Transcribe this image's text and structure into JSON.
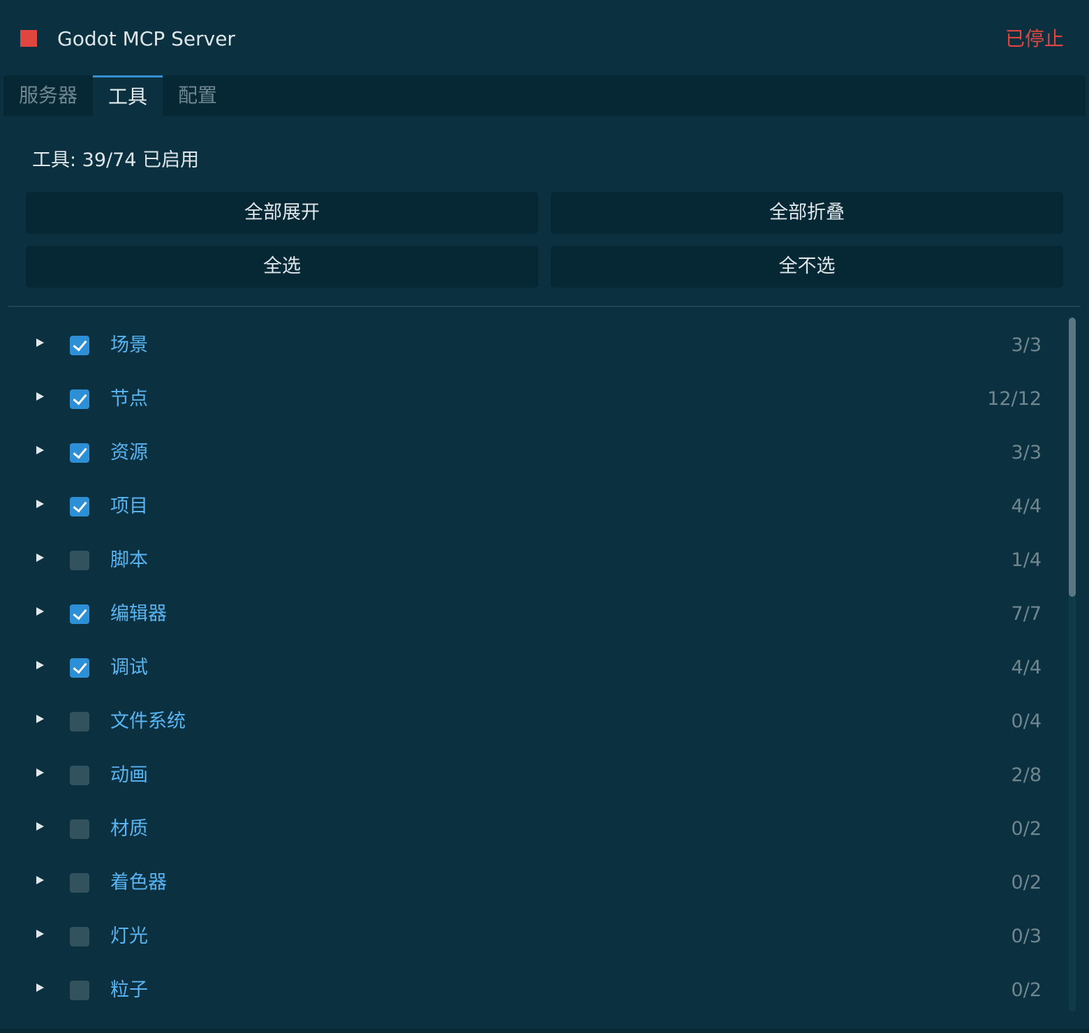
{
  "header": {
    "title": "Godot MCP Server",
    "status": "已停止",
    "status_color": "#e0463f"
  },
  "tabs": [
    {
      "label": "服务器",
      "active": false
    },
    {
      "label": "工具",
      "active": true
    },
    {
      "label": "配置",
      "active": false
    }
  ],
  "summary": "工具: 39/74 已启用",
  "buttons": {
    "expand_all": "全部展开",
    "collapse_all": "全部折叠",
    "select_all": "全选",
    "select_none": "全不选"
  },
  "categories": [
    {
      "label": "场景",
      "count": "3/3",
      "checked": true
    },
    {
      "label": "节点",
      "count": "12/12",
      "checked": true
    },
    {
      "label": "资源",
      "count": "3/3",
      "checked": true
    },
    {
      "label": "项目",
      "count": "4/4",
      "checked": true
    },
    {
      "label": "脚本",
      "count": "1/4",
      "checked": false
    },
    {
      "label": "编辑器",
      "count": "7/7",
      "checked": true
    },
    {
      "label": "调试",
      "count": "4/4",
      "checked": true
    },
    {
      "label": "文件系统",
      "count": "0/4",
      "checked": false
    },
    {
      "label": "动画",
      "count": "2/8",
      "checked": false
    },
    {
      "label": "材质",
      "count": "0/2",
      "checked": false
    },
    {
      "label": "着色器",
      "count": "0/2",
      "checked": false
    },
    {
      "label": "灯光",
      "count": "0/3",
      "checked": false
    },
    {
      "label": "粒子",
      "count": "0/2",
      "checked": false
    }
  ],
  "colors": {
    "background": "#0b3140",
    "panel": "#062834",
    "accent": "#2d8fd6",
    "label": "#58b4f2",
    "count": "#71868f"
  },
  "icons": {
    "status": "stop-square-icon",
    "expand": "triangle-right-icon",
    "check": "checkmark-icon"
  }
}
